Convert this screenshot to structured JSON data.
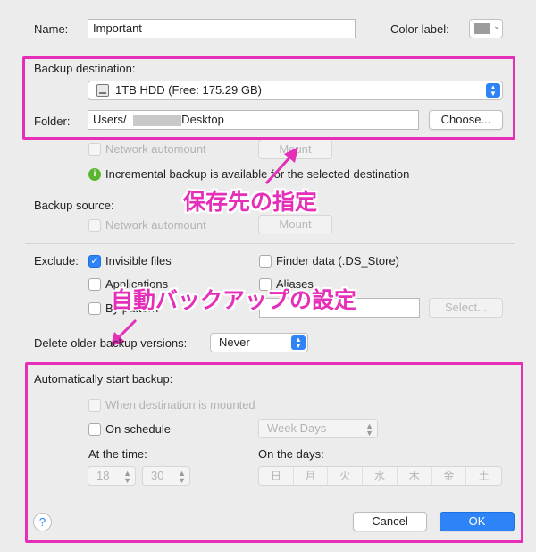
{
  "name": {
    "label": "Name:",
    "value": "Important"
  },
  "color_label": {
    "label": "Color label:",
    "value": "gray",
    "swatch_color": "#9c9c9c"
  },
  "backup_destination": {
    "label": "Backup destination:",
    "drive": "1TB HDD (Free: 175.29 GB)",
    "drive_icon": "hard-drive-icon",
    "folder_label": "Folder:",
    "folder_prefix": "Users/",
    "folder_suffix": "/Desktop",
    "choose_button": "Choose..."
  },
  "network_automount_label": "Network automount",
  "mount_button": "Mount",
  "info_message": "Incremental backup is available for the selected destination",
  "info_icon": "info-icon",
  "backup_source": {
    "label": "Backup source:",
    "network_automount_label": "Network automount",
    "mount_button": "Mount"
  },
  "exclude": {
    "label": "Exclude:",
    "invisible_files": "Invisible files",
    "invisible_files_checked": true,
    "finder_data": "Finder data (.DS_Store)",
    "applications": "Applications",
    "aliases": "Aliases",
    "by_pattern": "By pattern",
    "select_button": "Select..."
  },
  "delete_older": {
    "label": "Delete older backup versions:",
    "value": "Never"
  },
  "auto_start": {
    "label": "Automatically start backup:",
    "when_mounted": "When destination is mounted",
    "on_schedule": "On schedule",
    "schedule_value": "Week Days",
    "at_time_label": "At the time:",
    "hour": "18",
    "minute": "30",
    "on_days_label": "On the days:",
    "days": [
      "日",
      "月",
      "火",
      "水",
      "木",
      "金",
      "土"
    ]
  },
  "help_button": "?",
  "cancel_button": "Cancel",
  "ok_button": "OK",
  "annotations": {
    "destination": "保存先の指定",
    "auto_backup": "自動バックアップの設定"
  },
  "colors": {
    "accent": "#2e83f6",
    "annotation": "#e62fb9",
    "info_green": "#5cb531"
  }
}
